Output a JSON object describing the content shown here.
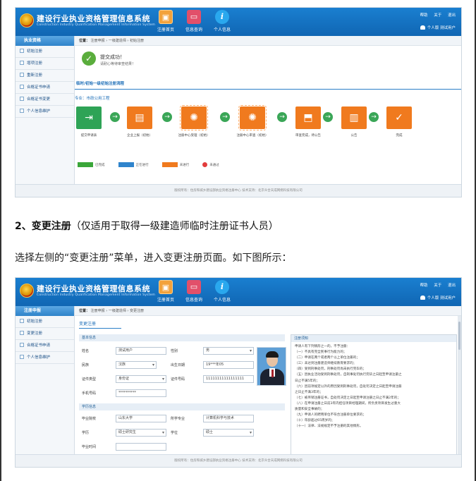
{
  "app": {
    "title": "建设行业执业资格管理信息系统",
    "subtitle": "Construction Industry Qualification Management Information System",
    "nav": {
      "home": "注册首页",
      "query": "信息查询",
      "info": "个人信息"
    },
    "top_links": [
      "帮助",
      "关于",
      "退出"
    ],
    "user": "个人版  测试用户",
    "footer": "版权所有：住房和城乡建设部执业资格注册中心    技术支持：北京众合天成网络科技有限公司"
  },
  "shot1": {
    "sidebar_header": "执业资格",
    "sidebar_items": [
      "初始注册",
      "增项注册",
      "重新注册",
      "合格证书申请",
      "合格证书变更",
      "个人信息维护"
    ],
    "breadcrumb": [
      "注册申报",
      "一级建造师",
      "初始注册"
    ],
    "breadcrumb_label": "位置：",
    "success_title": "提交成功！",
    "success_sub": "请耐心等待审查结果！",
    "tab": "临时/初始一级初始注册流程",
    "major": "专业：市政公用工程",
    "steps": [
      {
        "label": "提交申请表",
        "icon": "submit-form-icon",
        "glyph": "⇥"
      },
      {
        "label": "企业上报（初始）",
        "icon": "company-folder-icon",
        "glyph": "▤"
      },
      {
        "label": "注册中心受理（初始）",
        "icon": "gear-review-icon",
        "glyph": "✺"
      },
      {
        "label": "注册中心审查（初始）",
        "icon": "gear-review-icon",
        "glyph": "✺"
      },
      {
        "label": "审查完成，待公告",
        "icon": "stamp-icon",
        "glyph": "⬒"
      },
      {
        "label": "公告",
        "icon": "document-icon",
        "glyph": "▥"
      },
      {
        "label": "完成",
        "icon": "checkmark-icon",
        "glyph": "✓"
      }
    ],
    "legend": [
      {
        "label": "已完成",
        "color": "#3aa639"
      },
      {
        "label": "正在进行",
        "color": "#2f84cc"
      },
      {
        "label": "未进行",
        "color": "#f07a1e"
      },
      {
        "label": "未通过",
        "color": "#e23d3d"
      }
    ]
  },
  "prose": {
    "heading_num": "2、",
    "heading_bold": "变更注册",
    "heading_rest": "（仅适用于取得一级建造师临时注册证书人员）",
    "paragraph": "选择左侧的“变更注册”菜单，进入变更注册页面。如下图所示："
  },
  "shot2": {
    "sidebar_header": "注册申报",
    "sidebar_items": [
      "初始注册",
      "变更注册",
      "合格证书申请",
      "个人信息维护"
    ],
    "breadcrumb": [
      "注册申报",
      "一级建造师",
      "变更注册"
    ],
    "breadcrumb_label": "位置：",
    "form_title": "变更注册",
    "sections": {
      "basic": "基本信息",
      "education": "学历信息"
    },
    "fields": {
      "name_label": "姓名",
      "name_value": "测试用户",
      "gender_label": "性别",
      "gender_value": "男",
      "nation_label": "民族",
      "nation_value": "汉族",
      "birth_label": "出生日期",
      "birth_value": "19***年05",
      "idtype_label": "证件类型",
      "idtype_value": "身份证",
      "idno_label": "证件号码",
      "idno_value": "11111111111111111",
      "phone_label": "手机号码",
      "phone_value": "**********",
      "school_label": "毕业院校",
      "school_value": "山东大学",
      "major_label": "所学专业",
      "major_value": "计算机科学与技术",
      "edu_label": "学历",
      "edu_value": "硕士研究生",
      "degree_label": "学位",
      "degree_value": "硕士",
      "grad_label": "毕业时间"
    },
    "notice_title": "注册须知",
    "notice_lines": [
      "申请人有下列情形之一的，不予注册：",
      "（一）不具有完全民事行为能力的；",
      "（二）申请在两个或者两个以上单位注册的；",
      "（三）未达到注册建造师继续教育要求的；",
      "（四）受到刑事处罚，刑事处罚尚未执行完毕的；",
      "（五）因执业活动受到刑事处罚，自刑事处罚执行完毕之日起至申请注册之",
      "日止不满5年的；",
      "（六）因前项规定以外的原因受到刑事处罚，自处罚决定之日起至申请注册",
      "之日止不满3年的；",
      "（七）被吊销注册证书，自处罚决定之日起至申请注册之日止不满2年的；",
      "（八）在申请注册之日前3年内担任项目经理期间，所负责项目发生过重大",
      "质量和安全事故的；",
      "（九）申请人的聘用单位不符合注册单位要求的；",
      "（十）年龄超过65周岁的；",
      "（十一）法律、法规规定不予注册的其他情形。"
    ]
  }
}
